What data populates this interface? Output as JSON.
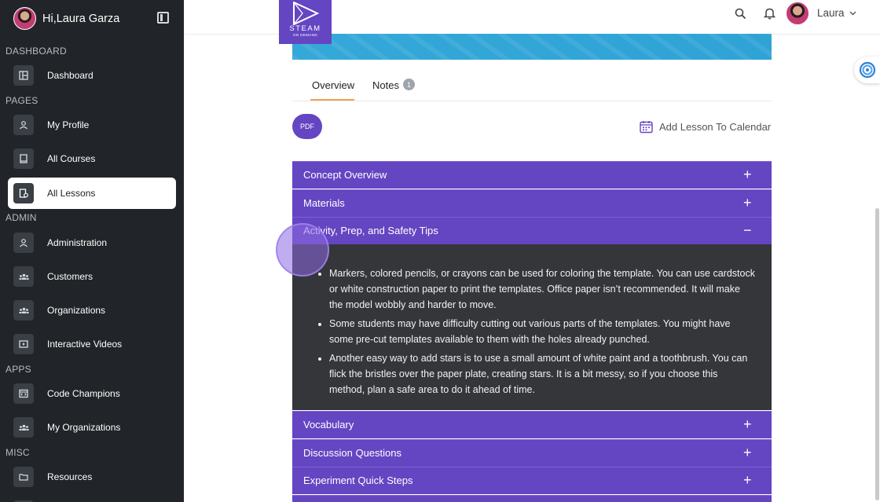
{
  "sidebar": {
    "greeting": "Hi,Laura Garza",
    "sections": {
      "dashboard": "DASHBOARD",
      "pages": "PAGES",
      "admin": "ADMIN",
      "apps": "APPS",
      "misc": "MISC"
    },
    "items": {
      "dashboard": "Dashboard",
      "my_profile": "My Profile",
      "all_courses": "All Courses",
      "all_lessons": "All Lessons",
      "administration": "Administration",
      "customers": "Customers",
      "organizations": "Organizations",
      "interactive_videos": "Interactive Videos",
      "code_champions": "Code Champions",
      "my_organizations": "My Organizations",
      "resources": "Resources"
    },
    "active_item": "All Lessons"
  },
  "header": {
    "logo_text": "STEAM",
    "logo_subtext": "ON DEMAND",
    "username": "Laura"
  },
  "tabs": {
    "overview": "Overview",
    "notes": "Notes",
    "notes_count": "1"
  },
  "actions": {
    "pdf": "PDF",
    "add_calendar": "Add Lesson To Calendar"
  },
  "accordion": {
    "concept_overview": "Concept Overview",
    "materials": "Materials",
    "activity": "Activity, Prep, and Safety Tips",
    "vocabulary": "Vocabulary",
    "discussion": "Discussion Questions",
    "experiment": "Experiment Quick Steps",
    "expand_symbol": "+",
    "collapse_symbol": "−",
    "activity_items": [
      "Markers, colored pencils, or crayons can be used for coloring the template. You can use cardstock or white construction paper to print the templates. Office paper isn’t recommended. It will make the model wobbly and harder to move.",
      "Some students may have difficulty cutting out various parts of the templates. You might have some pre-cut templates available to them with the holes already punched.",
      "Another easy way to add stars is to use a small amount of white paint and a toothbrush. You can flick the bristles over the paper plate, creating stars. It is a bit messy, so if you choose this method, plan a safe area to do it ahead of time."
    ]
  },
  "colors": {
    "sidebar_bg": "#212428",
    "accent_purple": "#6445c2",
    "tab_underline": "#f0a35a",
    "panel_dark": "#35363a"
  }
}
